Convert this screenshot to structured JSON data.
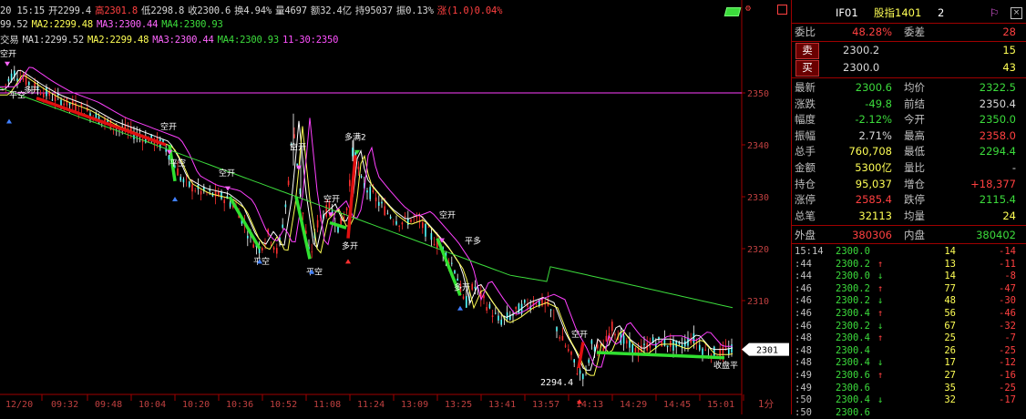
{
  "header": {
    "line1": {
      "time": "20 15:15",
      "open": "开2299.4",
      "high": "高2301.8",
      "low": "低2298.8",
      "close": "收2300.6",
      "turnover_rate": "换4.94%",
      "volume": "量4697",
      "amount": "额32.4亿",
      "holding": "持95037",
      "amplitude": "振0.13%",
      "change": "涨(1.0)0.04%"
    },
    "line2": {
      "ma_a": "99.52",
      "ma2": "MA2:2299.48",
      "ma3": "MA3:2300.44",
      "ma4": "MA4:2300.93"
    },
    "line3": {
      "name": "交易",
      "ma1": "MA1:2299.52",
      "ma2": "MA2:2299.48",
      "ma3": "MA3:2300.44",
      "ma4": "MA4:2300.93",
      "note": "11-30:2350"
    }
  },
  "chart": {
    "y_ticks": [
      "2350",
      "2340",
      "2330",
      "2320",
      "2310"
    ],
    "current_price_tag": "2301",
    "x_ticks": [
      "12/20",
      "09:32",
      "09:48",
      "10:04",
      "10:20",
      "10:36",
      "10:52",
      "11:08",
      "11:24",
      "13:09",
      "13:25",
      "13:41",
      "13:57",
      "14:13",
      "14:29",
      "14:45",
      "15:01"
    ],
    "period_label": "1分",
    "low_label": "2294.4",
    "signals": [
      {
        "text": "空开",
        "kind": "short-open"
      },
      {
        "text": "平空",
        "kind": "close-short"
      },
      {
        "text": "多开",
        "kind": "long-open"
      },
      {
        "text": "多满2",
        "kind": "long-full"
      },
      {
        "text": "平多",
        "kind": "close-long"
      },
      {
        "text": "收盘平",
        "kind": "close-at-end"
      }
    ]
  },
  "quote_panel": {
    "symbol": "IF01",
    "name": "股指1401",
    "page": "2",
    "weibi_label": "委比",
    "weibi_value": "48.28%",
    "weicha_label": "委差",
    "weicha_value": "28",
    "sell_label": "卖",
    "sell_price": "2300.2",
    "sell_qty": "15",
    "buy_label": "买",
    "buy_price": "2300.0",
    "buy_qty": "43",
    "stats": [
      {
        "l1": "最新",
        "v1": "2300.6",
        "c1": "#3cdc3c",
        "l2": "均价",
        "v2": "2322.5",
        "c2": "#3cdc3c"
      },
      {
        "l1": "涨跌",
        "v1": "-49.8",
        "c1": "#3cdc3c",
        "l2": "前结",
        "v2": "2350.4",
        "c2": "#d8d8d8"
      },
      {
        "l1": "幅度",
        "v1": "-2.12%",
        "c1": "#3cdc3c",
        "l2": "今开",
        "v2": "2350.0",
        "c2": "#3cdc3c"
      },
      {
        "l1": "振幅",
        "v1": "2.71%",
        "c1": "#d8d8d8",
        "l2": "最高",
        "v2": "2358.0",
        "c2": "#ff4040"
      },
      {
        "l1": "总手",
        "v1": "760,708",
        "c1": "#ffff55",
        "l2": "最低",
        "v2": "2294.4",
        "c2": "#3cdc3c"
      },
      {
        "l1": "金额",
        "v1": "5300亿",
        "c1": "#ffff55",
        "l2": "量比",
        "v2": "-",
        "c2": "#d8d8d8"
      },
      {
        "l1": "持仓",
        "v1": "95,037",
        "c1": "#ffff55",
        "l2": "增仓",
        "v2": "+18,377",
        "c2": "#ff4040"
      },
      {
        "l1": "涨停",
        "v1": "2585.4",
        "c1": "#ff4040",
        "l2": "跌停",
        "v2": "2115.4",
        "c2": "#3cdc3c"
      },
      {
        "l1": "总笔",
        "v1": "32113",
        "c1": "#ffff55",
        "l2": "均量",
        "v2": "24",
        "c2": "#ffff55"
      }
    ],
    "outer_label": "外盘",
    "outer_value": "380306",
    "inner_label": "内盘",
    "inner_value": "380402"
  },
  "ticks": [
    {
      "time": "15:14",
      "price": "2300.0",
      "arrow": "",
      "vol": "14",
      "chg": "-14"
    },
    {
      "time": ":44",
      "price": "2300.2",
      "arrow": "↑",
      "vol": "13",
      "chg": "-11"
    },
    {
      "time": ":44",
      "price": "2300.0",
      "arrow": "↓",
      "vol": "14",
      "chg": "-8"
    },
    {
      "time": ":46",
      "price": "2300.2",
      "arrow": "↑",
      "vol": "77",
      "chg": "-47"
    },
    {
      "time": ":46",
      "price": "2300.2",
      "arrow": "↓",
      "vol": "48",
      "chg": "-30"
    },
    {
      "time": ":46",
      "price": "2300.4",
      "arrow": "↑",
      "vol": "56",
      "chg": "-46"
    },
    {
      "time": ":46",
      "price": "2300.2",
      "arrow": "↓",
      "vol": "67",
      "chg": "-32"
    },
    {
      "time": ":48",
      "price": "2300.4",
      "arrow": "↑",
      "vol": "25",
      "chg": "-7"
    },
    {
      "time": ":48",
      "price": "2300.4",
      "arrow": "",
      "vol": "26",
      "chg": "-25"
    },
    {
      "time": ":48",
      "price": "2300.4",
      "arrow": "↓",
      "vol": "17",
      "chg": "-12"
    },
    {
      "time": ":49",
      "price": "2300.6",
      "arrow": "↑",
      "vol": "27",
      "chg": "-16"
    },
    {
      "time": ":49",
      "price": "2300.6",
      "arrow": "",
      "vol": "35",
      "chg": "-25"
    },
    {
      "time": ":50",
      "price": "2300.4",
      "arrow": "↓",
      "vol": "32",
      "chg": "-17"
    },
    {
      "time": ":50",
      "price": "2300.6",
      "arrow": "",
      "vol": "",
      "chg": ""
    }
  ]
}
